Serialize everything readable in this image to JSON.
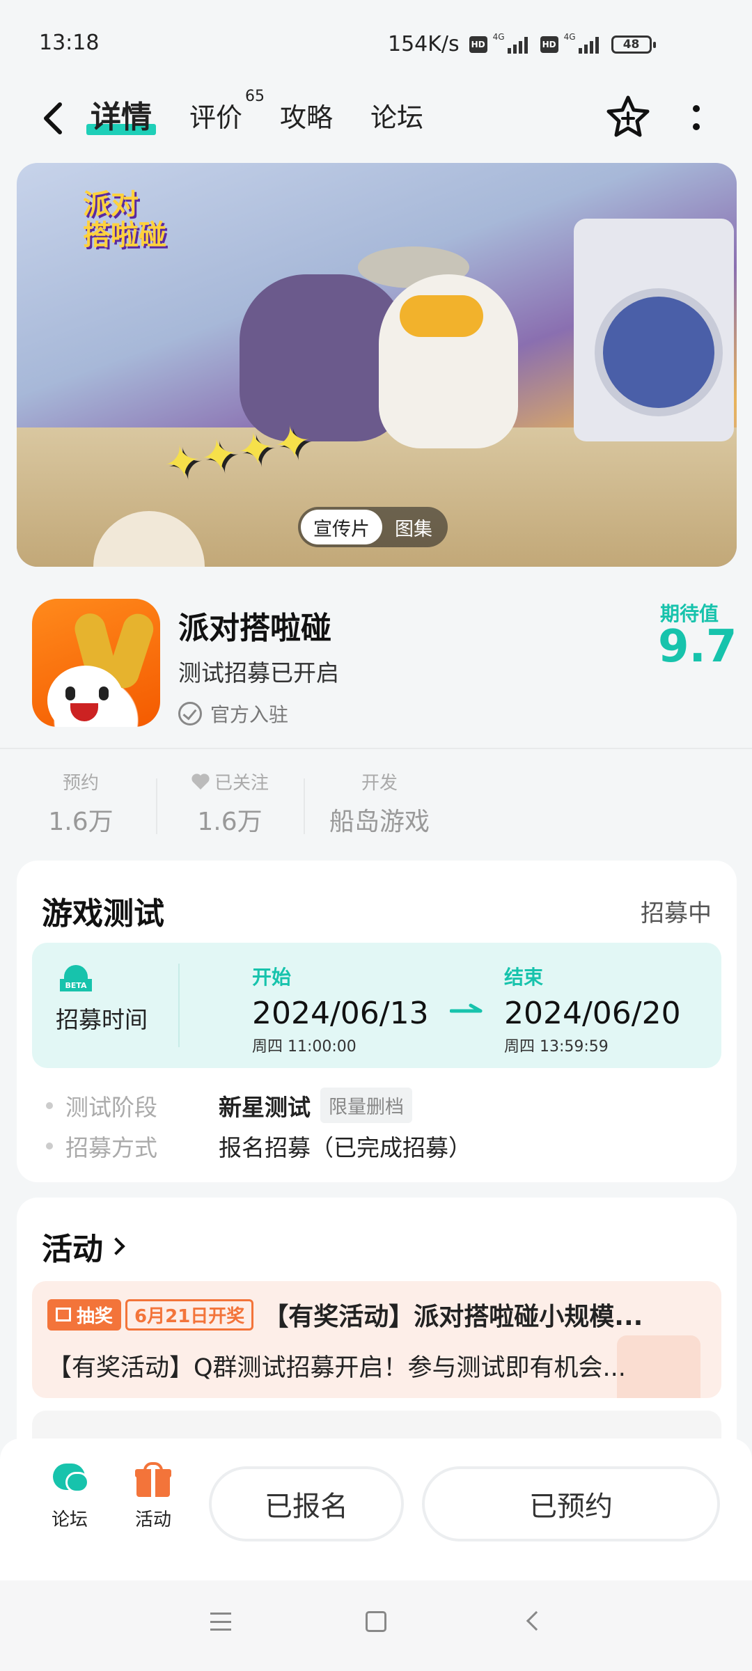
{
  "status_bar": {
    "time": "13:18",
    "speed": "154K/s",
    "hd": "HD",
    "net": "4G",
    "battery": "48"
  },
  "top_nav": {
    "tabs": [
      {
        "label": "详情",
        "active": true
      },
      {
        "label": "评价",
        "count": "65"
      },
      {
        "label": "攻略"
      },
      {
        "label": "论坛"
      }
    ],
    "star_icon": "star-plus-icon",
    "more_icon": "vertical-dots-icon"
  },
  "banner": {
    "logo_text_1": "派对",
    "logo_text_2": "搭啦碰",
    "toggle": [
      "宣传片",
      "图集"
    ],
    "active_toggle": "宣传片"
  },
  "app": {
    "name": "派对搭啦碰",
    "subtitle": "测试招募已开启",
    "official": "官方入驻",
    "expect_label": "期待值",
    "expect_score": "9.7"
  },
  "stats": [
    {
      "label": "预约",
      "value": "1.6万"
    },
    {
      "label": "已关注",
      "value": "1.6万",
      "icon": "heart-icon"
    },
    {
      "label": "开发",
      "value": "船岛游戏"
    }
  ],
  "test": {
    "title": "游戏测试",
    "status": "招募中",
    "recruit_label": "招募时间",
    "beta_badge": "BETA",
    "start_label": "开始",
    "start_date": "2024/06/13",
    "start_time": "周四   11:00:00",
    "end_label": "结束",
    "end_date": "2024/06/20",
    "end_time": "周四   13:59:59",
    "rows": [
      {
        "key": "测试阶段",
        "value": "新星测试",
        "tag": "限量删档"
      },
      {
        "key": "招募方式",
        "value": "报名招募（已完成招募）"
      }
    ]
  },
  "activity": {
    "title": "活动",
    "badge_lottery": "抽奖",
    "badge_date": "6月21日开奖",
    "headline": "【有奖活动】派对搭啦碰小规模...",
    "desc": "【有奖活动】Q群测试招募开启！参与测试即有机会..."
  },
  "bottom_bar": {
    "forum_label": "论坛",
    "activity_label": "活动",
    "signed_up": "已报名",
    "reserved": "已预约"
  },
  "colors": {
    "accent": "#17c3ac",
    "orange": "#f3743a"
  }
}
